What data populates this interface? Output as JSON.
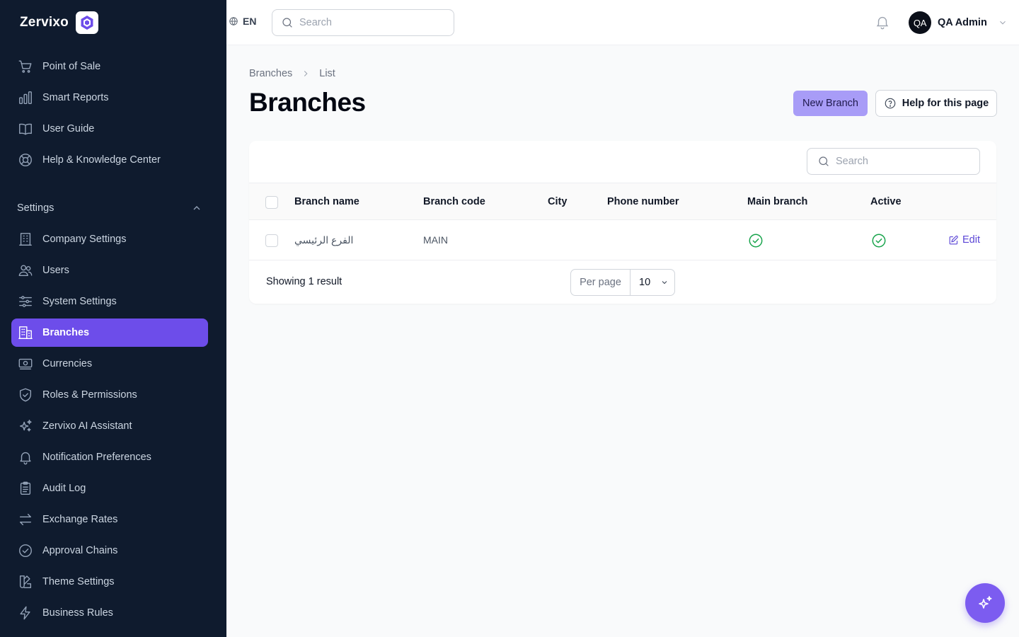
{
  "brand": {
    "name": "Zervixo"
  },
  "sidebar": {
    "top_items": [
      {
        "label": "Point of Sale",
        "icon": "cart-icon"
      },
      {
        "label": "Smart Reports",
        "icon": "bar-chart-icon"
      },
      {
        "label": "User Guide",
        "icon": "book-icon"
      },
      {
        "label": "Help & Knowledge Center",
        "icon": "lifebuoy-icon"
      }
    ],
    "group_label": "Settings",
    "settings_items": [
      {
        "label": "Company Settings",
        "icon": "building-icon"
      },
      {
        "label": "Users",
        "icon": "users-icon"
      },
      {
        "label": "System Settings",
        "icon": "sliders-icon"
      },
      {
        "label": "Branches",
        "icon": "office-building-icon",
        "active": true
      },
      {
        "label": "Currencies",
        "icon": "banknote-icon"
      },
      {
        "label": "Roles & Permissions",
        "icon": "shield-icon"
      },
      {
        "label": "Zervixo AI Assistant",
        "icon": "sparkles-icon"
      },
      {
        "label": "Notification Preferences",
        "icon": "bell-icon"
      },
      {
        "label": "Audit Log",
        "icon": "clipboard-icon"
      },
      {
        "label": "Exchange Rates",
        "icon": "arrows-exchange-icon"
      },
      {
        "label": "Approval Chains",
        "icon": "check-badge-icon"
      },
      {
        "label": "Theme Settings",
        "icon": "swatch-icon"
      },
      {
        "label": "Business Rules",
        "icon": "bolt-icon"
      }
    ]
  },
  "topbar": {
    "language": "EN",
    "search_placeholder": "Search",
    "user_initials": "QA",
    "user_name": "QA Admin"
  },
  "breadcrumb": {
    "parent": "Branches",
    "current": "List"
  },
  "page": {
    "title": "Branches",
    "new_button": "New Branch",
    "help_button": "Help for this page"
  },
  "table": {
    "search_placeholder": "Search",
    "columns": [
      "Branch name",
      "Branch code",
      "City",
      "Phone number",
      "Main branch",
      "Active"
    ],
    "rows": [
      {
        "branch_name": "الفرع الرئيسي",
        "branch_code": "MAIN",
        "city": "",
        "phone": "",
        "main_branch": true,
        "active": true,
        "edit_label": "Edit"
      }
    ],
    "showing": "Showing 1 result",
    "per_page_label": "Per page",
    "per_page_value": "10"
  },
  "colors": {
    "sidebar_bg": "#0f1b2e",
    "accent": "#6d4dea",
    "success": "#16a34a"
  }
}
